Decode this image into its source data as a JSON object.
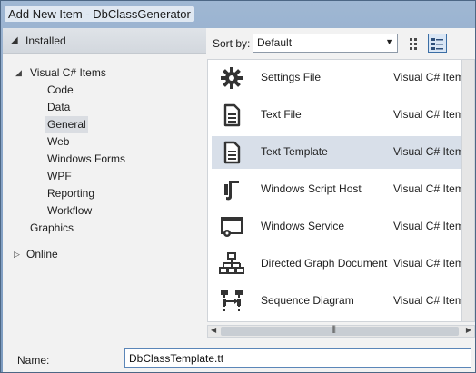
{
  "window": {
    "title": "Add New Item - DbClassGenerator"
  },
  "left": {
    "installed_label": "Installed",
    "tree": [
      {
        "label": "Visual C# Items",
        "level": 0,
        "expanded": true,
        "selected": false
      },
      {
        "label": "Code",
        "level": 1,
        "selected": false
      },
      {
        "label": "Data",
        "level": 1,
        "selected": false
      },
      {
        "label": "General",
        "level": 1,
        "selected": true
      },
      {
        "label": "Web",
        "level": 1,
        "selected": false
      },
      {
        "label": "Windows Forms",
        "level": 1,
        "selected": false
      },
      {
        "label": "WPF",
        "level": 1,
        "selected": false
      },
      {
        "label": "Reporting",
        "level": 1,
        "selected": false
      },
      {
        "label": "Workflow",
        "level": 1,
        "selected": false
      },
      {
        "label": "Graphics",
        "level": 0,
        "selected": false
      }
    ],
    "online_label": "Online"
  },
  "sort": {
    "label": "Sort by:",
    "value": "Default"
  },
  "items": [
    {
      "name": "Settings File",
      "type": "Visual C# Items",
      "icon": "gear-icon",
      "selected": false
    },
    {
      "name": "Text File",
      "type": "Visual C# Items",
      "icon": "document-icon",
      "selected": false
    },
    {
      "name": "Text Template",
      "type": "Visual C# Items",
      "icon": "document-icon",
      "selected": true
    },
    {
      "name": "Windows Script Host",
      "type": "Visual C# Items",
      "icon": "script-icon",
      "selected": false
    },
    {
      "name": "Windows Service",
      "type": "Visual C# Items",
      "icon": "service-icon",
      "selected": false
    },
    {
      "name": "Directed Graph Document",
      "type": "Visual C# Items",
      "icon": "graph-icon",
      "selected": false
    },
    {
      "name": "Sequence Diagram",
      "type": "Visual C# Items",
      "icon": "sequence-icon",
      "selected": false
    }
  ],
  "bottom": {
    "name_label": "Name:",
    "name_value": "DbClassTemplate.tt"
  }
}
